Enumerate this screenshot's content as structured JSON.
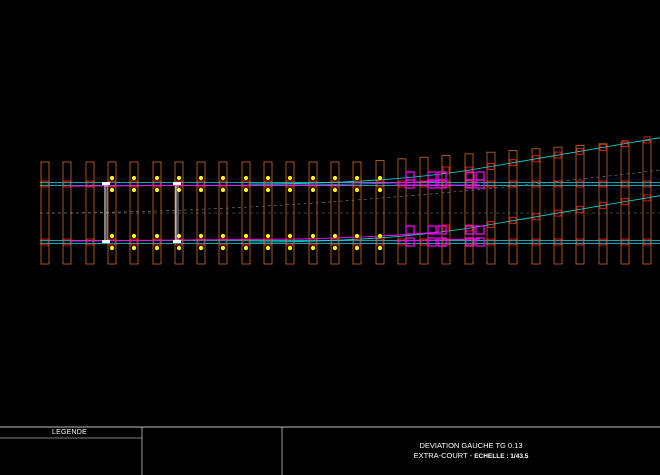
{
  "drawing": {
    "background": "#000000",
    "colors": {
      "sleeper": "#d2691e",
      "rail": "#00e5e5",
      "rail_pad": "#ff2020",
      "check_rail": "#ff00ff",
      "fastener": "#ffff00",
      "axis": "#808080",
      "frame": "#ffffff"
    },
    "sleepers_count": 28,
    "icons": [
      "fastener-icon",
      "rail-brace-icon",
      "tie-bar-icon"
    ]
  },
  "title_block": {
    "legend_label": "LEGENDE",
    "line1": "DEVIATION GAUCHE TG 0.13",
    "line2_prefix": "EXTRA-COURT - ",
    "line2_scale": "ECHELLE : 1/43.5"
  }
}
